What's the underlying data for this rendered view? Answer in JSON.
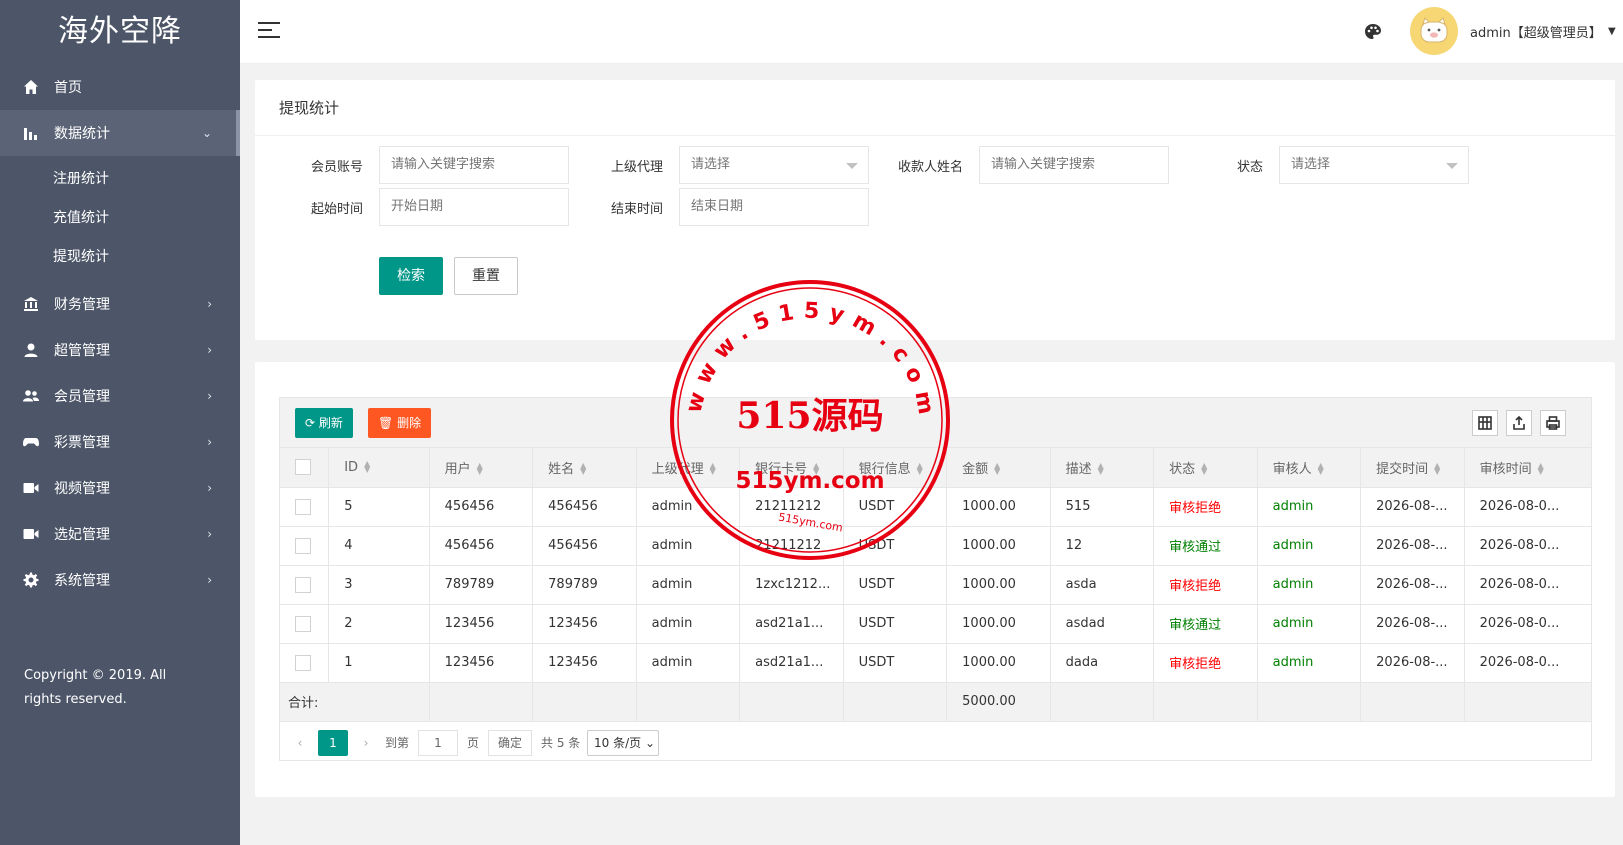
{
  "sidebar": {
    "logo": "海外空降",
    "items": [
      {
        "label": "首页",
        "icon": "home-icon"
      },
      {
        "label": "数据统计",
        "icon": "bar-chart-icon",
        "open": true
      },
      {
        "label": "财务管理",
        "icon": "bank-icon"
      },
      {
        "label": "超管管理",
        "icon": "user-icon"
      },
      {
        "label": "会员管理",
        "icon": "users-icon"
      },
      {
        "label": "彩票管理",
        "icon": "gamepad-icon"
      },
      {
        "label": "视频管理",
        "icon": "video-icon"
      },
      {
        "label": "选妃管理",
        "icon": "video-icon"
      },
      {
        "label": "系统管理",
        "icon": "gear-icon"
      }
    ],
    "sub_items": [
      "注册统计",
      "充值统计",
      "提现统计"
    ],
    "copyright": "Copyright © 2019. All rights reserved."
  },
  "header": {
    "user": "admin【超级管理员】"
  },
  "filter": {
    "title": "提现统计",
    "member_label": "会员账号",
    "member_placeholder": "请输入关键字搜索",
    "agent_label": "上级代理",
    "agent_placeholder": "请选择",
    "payee_label": "收款人姓名",
    "payee_placeholder": "请输入关键字搜索",
    "status_label": "状态",
    "status_placeholder": "请选择",
    "start_label": "起始时间",
    "start_placeholder": "开始日期",
    "end_label": "结束时间",
    "end_placeholder": "结束日期",
    "search_button": "检索",
    "reset_button": "重置"
  },
  "toolbar": {
    "refresh": "刷新",
    "delete": "删除"
  },
  "table": {
    "columns": [
      "ID",
      "用户",
      "姓名",
      "上级代理",
      "银行卡号",
      "银行信息",
      "金额",
      "描述",
      "状态",
      "审核人",
      "提交时间",
      "审核时间"
    ],
    "rows": [
      {
        "id": "5",
        "user": "456456",
        "name": "456456",
        "agent": "admin",
        "card": "21211212",
        "bank": "USDT",
        "amount": "1000.00",
        "desc": "515",
        "status": "审核拒绝",
        "status_type": "reject",
        "auditor": "admin",
        "submit": "2026-08-...",
        "audit": "2026-08-0..."
      },
      {
        "id": "4",
        "user": "456456",
        "name": "456456",
        "agent": "admin",
        "card": "21211212",
        "bank": "USDT",
        "amount": "1000.00",
        "desc": "12",
        "status": "审核通过",
        "status_type": "pass",
        "auditor": "admin",
        "submit": "2026-08-...",
        "audit": "2026-08-0..."
      },
      {
        "id": "3",
        "user": "789789",
        "name": "789789",
        "agent": "admin",
        "card": "1zxc1212...",
        "bank": "USDT",
        "amount": "1000.00",
        "desc": "asda",
        "status": "审核拒绝",
        "status_type": "reject",
        "auditor": "admin",
        "submit": "2026-08-...",
        "audit": "2026-08-0..."
      },
      {
        "id": "2",
        "user": "123456",
        "name": "123456",
        "agent": "admin",
        "card": "asd21a1...",
        "bank": "USDT",
        "amount": "1000.00",
        "desc": "asdad",
        "status": "审核通过",
        "status_type": "pass",
        "auditor": "admin",
        "submit": "2026-08-...",
        "audit": "2026-08-0..."
      },
      {
        "id": "1",
        "user": "123456",
        "name": "123456",
        "agent": "admin",
        "card": "asd21a1...",
        "bank": "USDT",
        "amount": "1000.00",
        "desc": "dada",
        "status": "审核拒绝",
        "status_type": "reject",
        "auditor": "admin",
        "submit": "2026-08-...",
        "audit": "2026-08-0..."
      }
    ],
    "total_label": "合计:",
    "total_amount": "5000.00"
  },
  "pager": {
    "current": "1",
    "goto": "到第",
    "page_input": "1",
    "page_unit": "页",
    "confirm": "确定",
    "total": "共 5 条",
    "size": "10 条/页"
  },
  "watermark": {
    "ring_text": "www.515ym.com",
    "center": "515源码",
    "domain": "515ym.com",
    "small": "515ym.com"
  },
  "colors": {
    "sidebar": "#4d5668",
    "primary": "#009688",
    "danger": "#ff5722",
    "reject": "#ff0000",
    "pass": "#008000",
    "stamp": "#e60012"
  }
}
